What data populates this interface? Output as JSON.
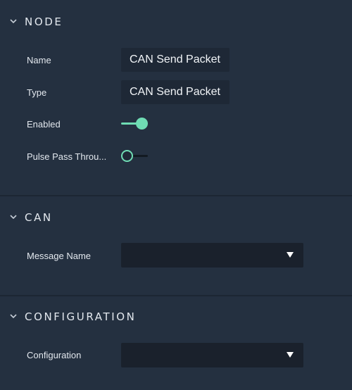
{
  "node": {
    "title": "NODE",
    "chevron_icon": "chevron-down-icon",
    "name_label": "Name",
    "name_value": "CAN Send Packet",
    "type_label": "Type",
    "type_value": "CAN Send Packet",
    "enabled_label": "Enabled",
    "enabled_state": true,
    "pulse_label": "Pulse Pass Throu...",
    "pulse_state": false
  },
  "can": {
    "title": "CAN",
    "chevron_icon": "chevron-down-icon",
    "message_name_label": "Message Name",
    "message_name_value": ""
  },
  "configuration": {
    "title": "CONFIGURATION",
    "chevron_icon": "chevron-down-icon",
    "configuration_label": "Configuration",
    "configuration_value": ""
  },
  "colors": {
    "background": "#243040",
    "accent": "#6fdcb4",
    "field": "#1e2836",
    "select": "#1a212c"
  }
}
